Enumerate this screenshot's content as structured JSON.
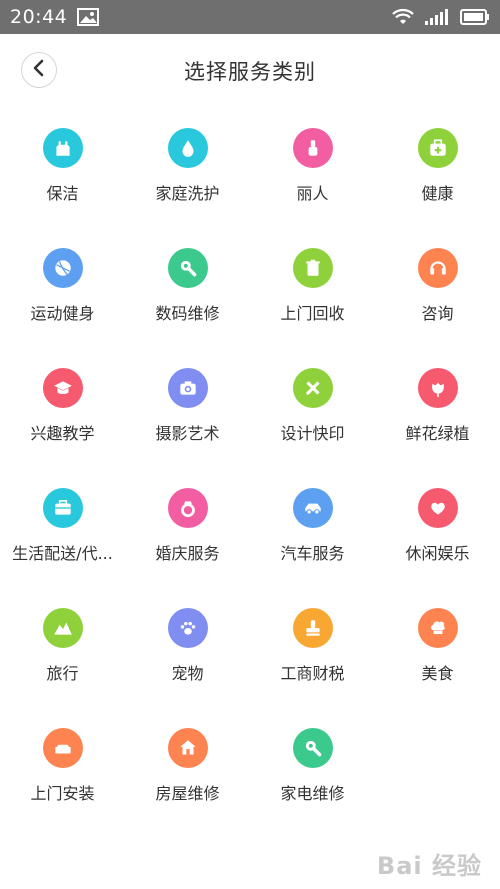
{
  "status_bar": {
    "time": "20:44",
    "icons": [
      "image-icon",
      "wifi-icon",
      "signal-icon",
      "battery-icon"
    ],
    "background": "#6f6f6f"
  },
  "header": {
    "title": "选择服务类别",
    "back_icon": "chevron-left-icon"
  },
  "categories": [
    {
      "label": "保洁",
      "icon": "cleaning-icon",
      "color": "#29c8dc"
    },
    {
      "label": "家庭洗护",
      "icon": "water-drop-icon",
      "color": "#29c8dc"
    },
    {
      "label": "丽人",
      "icon": "nail-polish-icon",
      "color": "#f25ea1"
    },
    {
      "label": "健康",
      "icon": "medical-kit-icon",
      "color": "#8ed13a"
    },
    {
      "label": "运动健身",
      "icon": "ball-icon",
      "color": "#5d9ff0"
    },
    {
      "label": "数码维修",
      "icon": "wrench-icon",
      "color": "#3cc98d"
    },
    {
      "label": "上门回收",
      "icon": "trash-icon",
      "color": "#8ed13a"
    },
    {
      "label": "咨询",
      "icon": "headset-icon",
      "color": "#fd8451"
    },
    {
      "label": "兴趣教学",
      "icon": "graduation-cap-icon",
      "color": "#f55a6e"
    },
    {
      "label": "摄影艺术",
      "icon": "camera-icon",
      "color": "#7f8ef0"
    },
    {
      "label": "设计快印",
      "icon": "ruler-pencil-icon",
      "color": "#8ed13a"
    },
    {
      "label": "鲜花绿植",
      "icon": "flower-icon",
      "color": "#f55a6e"
    },
    {
      "label": "生活配送/代...",
      "icon": "briefcase-icon",
      "color": "#29c8dc"
    },
    {
      "label": "婚庆服务",
      "icon": "ring-icon",
      "color": "#f25ea1"
    },
    {
      "label": "汽车服务",
      "icon": "car-icon",
      "color": "#5d9ff0"
    },
    {
      "label": "休闲娱乐",
      "icon": "heart-icon",
      "color": "#f55a6e"
    },
    {
      "label": "旅行",
      "icon": "mountain-icon",
      "color": "#8ed13a"
    },
    {
      "label": "宠物",
      "icon": "paw-icon",
      "color": "#7f8ef0"
    },
    {
      "label": "工商财税",
      "icon": "stamp-icon",
      "color": "#f9a733"
    },
    {
      "label": "美食",
      "icon": "chef-hat-icon",
      "color": "#fd8451"
    },
    {
      "label": "上门安装",
      "icon": "sofa-icon",
      "color": "#fd8451"
    },
    {
      "label": "房屋维修",
      "icon": "house-icon",
      "color": "#fd8451"
    },
    {
      "label": "家电维修",
      "icon": "wrench-icon",
      "color": "#3cc98d"
    }
  ],
  "watermark": "Bai 经验"
}
